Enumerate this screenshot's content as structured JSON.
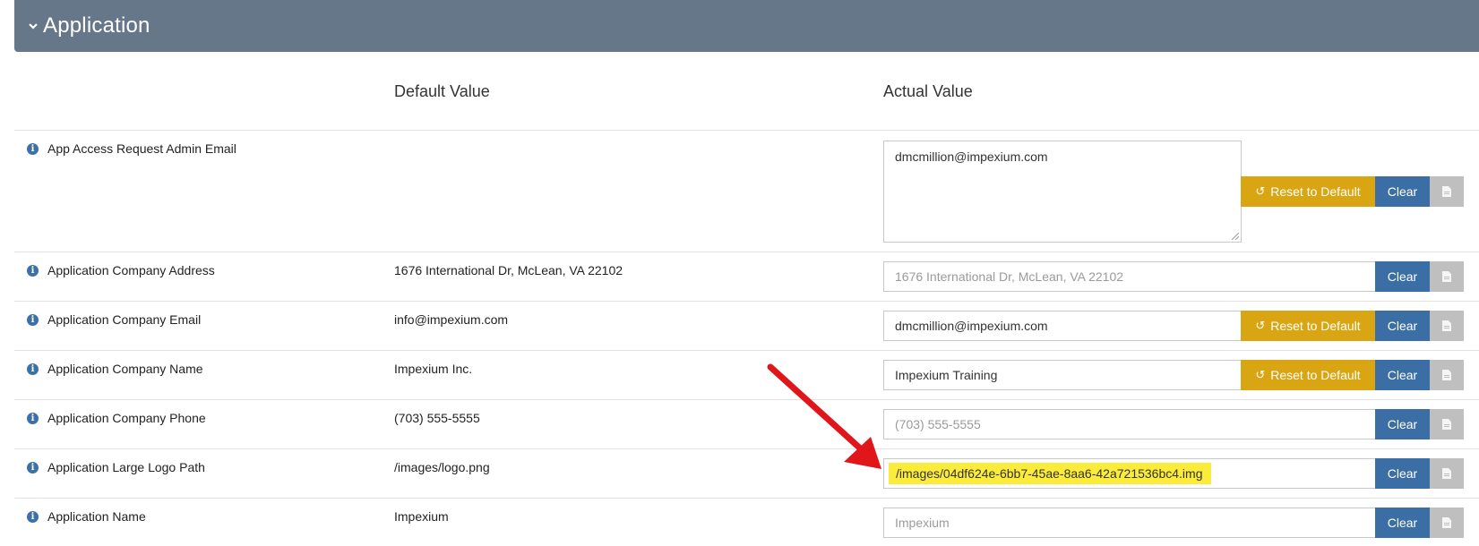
{
  "section": {
    "title": "Application"
  },
  "columns": {
    "default": "Default Value",
    "actual": "Actual Value"
  },
  "buttons": {
    "reset_label": "Reset to Default",
    "clear_label": "Clear"
  },
  "rows": [
    {
      "label": "App Access Request Admin Email",
      "default": "",
      "actual": "dmcmillion@impexium.com",
      "placeholder": ""
    },
    {
      "label": "Application Company Address",
      "default": "1676 International Dr, McLean, VA 22102",
      "actual": "",
      "placeholder": "1676 International Dr, McLean, VA 22102"
    },
    {
      "label": "Application Company Email",
      "default": "info@impexium.com",
      "actual": "dmcmillion@impexium.com",
      "placeholder": ""
    },
    {
      "label": "Application Company Name",
      "default": "Impexium Inc.",
      "actual": "Impexium Training",
      "placeholder": ""
    },
    {
      "label": "Application Company Phone",
      "default": "(703) 555-5555",
      "actual": "",
      "placeholder": "(703) 555-5555"
    },
    {
      "label": "Application Large Logo Path",
      "default": "/images/logo.png",
      "actual": "/images/04df624e-6bb7-45ae-8aa6-42a721536bc4.img",
      "placeholder": ""
    },
    {
      "label": "Application Name",
      "default": "Impexium",
      "actual": "",
      "placeholder": "Impexium"
    }
  ],
  "colors": {
    "header_bg": "#667789",
    "reset_button": "#d9a512",
    "clear_button": "#3a6ea5",
    "file_button": "#bfbfbf",
    "highlight": "#fbeb3a",
    "annotation_arrow": "#e0161b"
  }
}
